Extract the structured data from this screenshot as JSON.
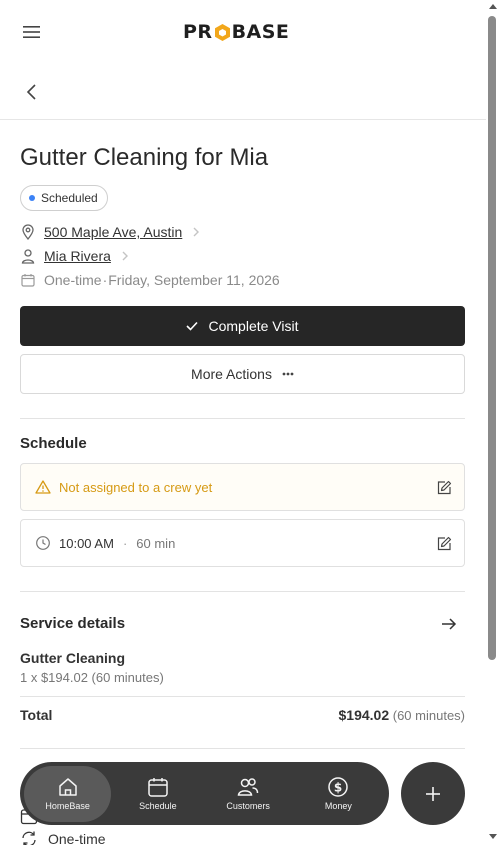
{
  "app": {
    "brand": "PROBASE"
  },
  "job": {
    "title": "Gutter Cleaning for Mia",
    "status": "Scheduled",
    "address": "500 Maple Ave, Austin",
    "customer": "Mia Rivera",
    "recurrence": "One-time",
    "separator": "·",
    "date": "Friday, September 11, 2026"
  },
  "actions": {
    "complete_label": "Complete Visit",
    "more_label": "More Actions"
  },
  "schedule": {
    "title": "Schedule",
    "crew_warning": "Not assigned to a crew yet",
    "time": "10:00 AM",
    "separator": "·",
    "duration": "60 min"
  },
  "service_details": {
    "title": "Service details",
    "item_name": "Gutter Cleaning",
    "item_detail": "1 x $194.02 (60 minutes)",
    "total_label": "Total",
    "total_amount": "$194.02",
    "total_duration": "(60 minutes)",
    "recurrence": "One-time"
  },
  "nav": {
    "items": [
      {
        "label": "HomeBase",
        "icon": "home-icon",
        "active": true
      },
      {
        "label": "Schedule",
        "icon": "calendar-icon",
        "active": false
      },
      {
        "label": "Customers",
        "icon": "customers-icon",
        "active": false
      },
      {
        "label": "Money",
        "icon": "money-icon",
        "active": false
      }
    ]
  },
  "colors": {
    "status_dot": "#3b82f6",
    "warning": "#d69a14",
    "primary_button": "#262626",
    "nav_bg": "#3a3a3a"
  }
}
